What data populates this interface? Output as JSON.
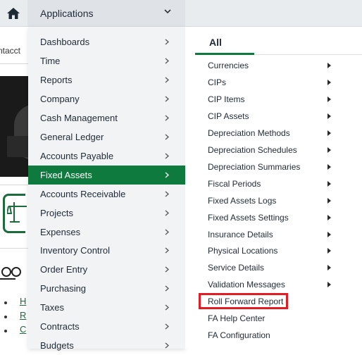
{
  "topbar": {
    "home_icon": "home-icon",
    "apps_label": "Applications",
    "apps_chevron_icon": "chevron-down-icon"
  },
  "background": {
    "contact_fragment": "ntacct",
    "links": [
      "H",
      "R",
      "C"
    ]
  },
  "left_menu": {
    "items": [
      {
        "label": "Dashboards",
        "active": false
      },
      {
        "label": "Time",
        "active": false
      },
      {
        "label": "Reports",
        "active": false
      },
      {
        "label": "Company",
        "active": false
      },
      {
        "label": "Cash Management",
        "active": false
      },
      {
        "label": "General Ledger",
        "active": false
      },
      {
        "label": "Accounts Payable",
        "active": false
      },
      {
        "label": "Fixed Assets",
        "active": true
      },
      {
        "label": "Accounts Receivable",
        "active": false
      },
      {
        "label": "Projects",
        "active": false
      },
      {
        "label": "Expenses",
        "active": false
      },
      {
        "label": "Inventory Control",
        "active": false
      },
      {
        "label": "Order Entry",
        "active": false
      },
      {
        "label": "Purchasing",
        "active": false
      },
      {
        "label": "Taxes",
        "active": false
      },
      {
        "label": "Contracts",
        "active": false
      },
      {
        "label": "Budgets",
        "active": false
      }
    ],
    "active_color": "#0f7a3e"
  },
  "right_panel": {
    "tab_label": "All",
    "items": [
      {
        "label": "Currencies",
        "has_submenu": true
      },
      {
        "label": "CIPs",
        "has_submenu": true
      },
      {
        "label": "CIP Items",
        "has_submenu": true
      },
      {
        "label": "CIP Assets",
        "has_submenu": true
      },
      {
        "label": "Depreciation Methods",
        "has_submenu": true
      },
      {
        "label": "Depreciation Schedules",
        "has_submenu": true
      },
      {
        "label": "Depreciation Summaries",
        "has_submenu": true
      },
      {
        "label": "Fiscal Periods",
        "has_submenu": true
      },
      {
        "label": "Fixed Assets Logs",
        "has_submenu": true
      },
      {
        "label": "Fixed Assets Settings",
        "has_submenu": true
      },
      {
        "label": "Insurance Details",
        "has_submenu": true
      },
      {
        "label": "Physical Locations",
        "has_submenu": true
      },
      {
        "label": "Service Details",
        "has_submenu": true
      },
      {
        "label": "Validation Messages",
        "has_submenu": true
      },
      {
        "label": "Roll Forward Report",
        "has_submenu": false,
        "highlighted": true
      },
      {
        "label": "FA Help Center",
        "has_submenu": false
      },
      {
        "label": "FA Configuration",
        "has_submenu": false
      }
    ],
    "highlight_color": "#e31b23"
  }
}
